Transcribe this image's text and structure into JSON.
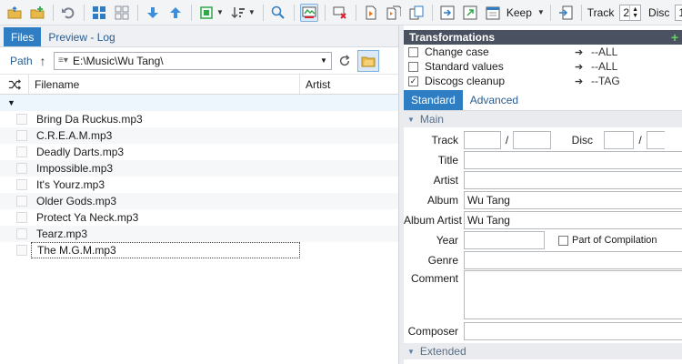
{
  "toolbar": {
    "keep_label": "Keep",
    "track_label": "Track",
    "track_value": "2",
    "disc_label": "Disc",
    "disc_value": "1"
  },
  "left": {
    "tabs": [
      {
        "label": "Files",
        "selected": true
      },
      {
        "label": "Preview - Log",
        "selected": false
      }
    ],
    "path_label": "Path",
    "path_value": "E:\\Music\\Wu Tang\\",
    "columns": {
      "filename": "Filename",
      "artist": "Artist"
    },
    "files": [
      "Bring Da Ruckus.mp3",
      "C.R.E.A.M.mp3",
      "Deadly Darts.mp3",
      "Impossible.mp3",
      "It's Yourz.mp3",
      "Older Gods.mp3",
      "Protect Ya Neck.mp3",
      "Tearz.mp3",
      "The M.G.M.mp3"
    ]
  },
  "right": {
    "transformations_title": "Transformations",
    "transformations": [
      {
        "name": "Change case",
        "target": "--ALL",
        "checked": false
      },
      {
        "name": "Standard values",
        "target": "--ALL",
        "checked": false
      },
      {
        "name": "Discogs cleanup",
        "target": "--TAG",
        "checked": true
      }
    ],
    "tabs": [
      {
        "label": "Standard",
        "selected": true
      },
      {
        "label": "Advanced",
        "selected": false
      }
    ],
    "section_main": "Main",
    "section_extended": "Extended",
    "fields": {
      "track_label": "Track",
      "disc_label": "Disc",
      "slash": "/",
      "title_label": "Title",
      "artist_label": "Artist",
      "album_label": "Album",
      "album_value": "Wu Tang",
      "album_artist_label": "Album Artist",
      "album_artist_value": "Wu Tang",
      "year_label": "Year",
      "compilation_label": "Part of Compilation",
      "genre_label": "Genre",
      "comment_label": "Comment",
      "composer_label": "Composer"
    }
  },
  "colors": {
    "accent": "#2f7dc2",
    "header_dark": "#4a5160",
    "plus_green": "#5fd35a"
  }
}
